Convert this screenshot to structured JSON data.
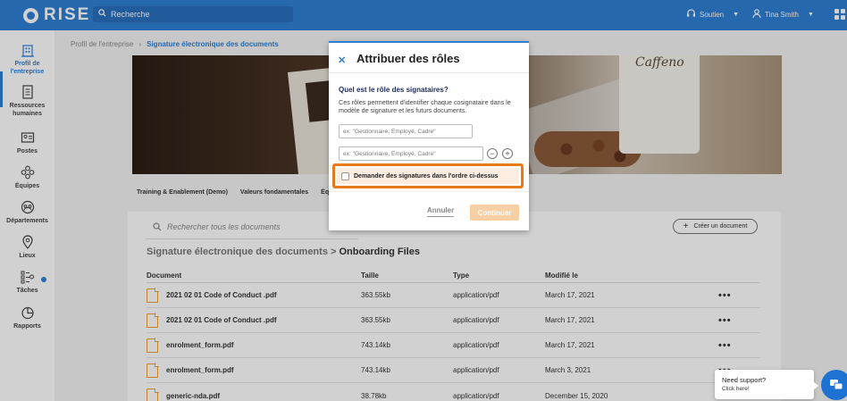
{
  "app": {
    "logo": "RISE",
    "search_placeholder": "Recherche",
    "support_label": "Soutien",
    "user_name": "Tina Smith"
  },
  "sidebar": {
    "items": [
      {
        "label": "Profil de l'entreprise",
        "icon": "building-icon",
        "active": true
      },
      {
        "label": "Ressources humaines",
        "icon": "document-icon"
      },
      {
        "label": "Postes",
        "icon": "id-card-icon"
      },
      {
        "label": "Équipes",
        "icon": "team-icon"
      },
      {
        "label": "Départements",
        "icon": "department-icon"
      },
      {
        "label": "Lieux",
        "icon": "location-pin-icon"
      },
      {
        "label": "Tâches",
        "icon": "tasks-icon"
      },
      {
        "label": "Rapports",
        "icon": "pie-chart-icon"
      }
    ]
  },
  "breadcrumb": {
    "parent": "Profil de l'entreprise",
    "current": "Signature électronique des documents"
  },
  "banner": {
    "cup_text": "Caffeno"
  },
  "tabs": [
    "Training & Enablement (Demo)",
    "Valeurs fondamentales",
    "Éq"
  ],
  "documents": {
    "search_placeholder": "Rechercher tous les documents",
    "create_label": "Créer un document",
    "path_parent": "Signature électronique des documents",
    "path_sep": ">",
    "path_leaf": "Onboarding Files",
    "columns": [
      "Document",
      "Taille",
      "Type",
      "Modifié le"
    ],
    "rows": [
      {
        "name": "2021 02 01 Code of Conduct .pdf",
        "size": "363.55kb",
        "type": "application/pdf",
        "modified": "March 17, 2021"
      },
      {
        "name": "2021 02 01 Code of Conduct .pdf",
        "size": "363.55kb",
        "type": "application/pdf",
        "modified": "March 17, 2021"
      },
      {
        "name": "enrolment_form.pdf",
        "size": "743.14kb",
        "type": "application/pdf",
        "modified": "March 17, 2021"
      },
      {
        "name": "enrolment_form.pdf",
        "size": "743.14kb",
        "type": "application/pdf",
        "modified": "March 3, 2021"
      },
      {
        "name": "generic-nda.pdf",
        "size": "38.78kb",
        "type": "application/pdf",
        "modified": "December 15, 2020"
      }
    ],
    "row_action": "•••"
  },
  "modal": {
    "title": "Attribuer des rôles",
    "question": "Quel est le rôle des signataires?",
    "description": "Ces rôles permettent d'identifier chaque cosignataire dans le modèle de signature et les futurs documents.",
    "input_placeholder": "ex: \"Gestionnaire, Employé, Cadre\"",
    "checkbox_label": "Demander des signatures dans l'ordre ci-dessus",
    "cancel_label": "Annuler",
    "continue_label": "Continuer"
  },
  "support": {
    "title": "Need support?",
    "subtitle": "Click here!"
  },
  "colors": {
    "brand": "#2f7fd4",
    "highlight": "#e87a1a",
    "file": "#e8a23a"
  }
}
